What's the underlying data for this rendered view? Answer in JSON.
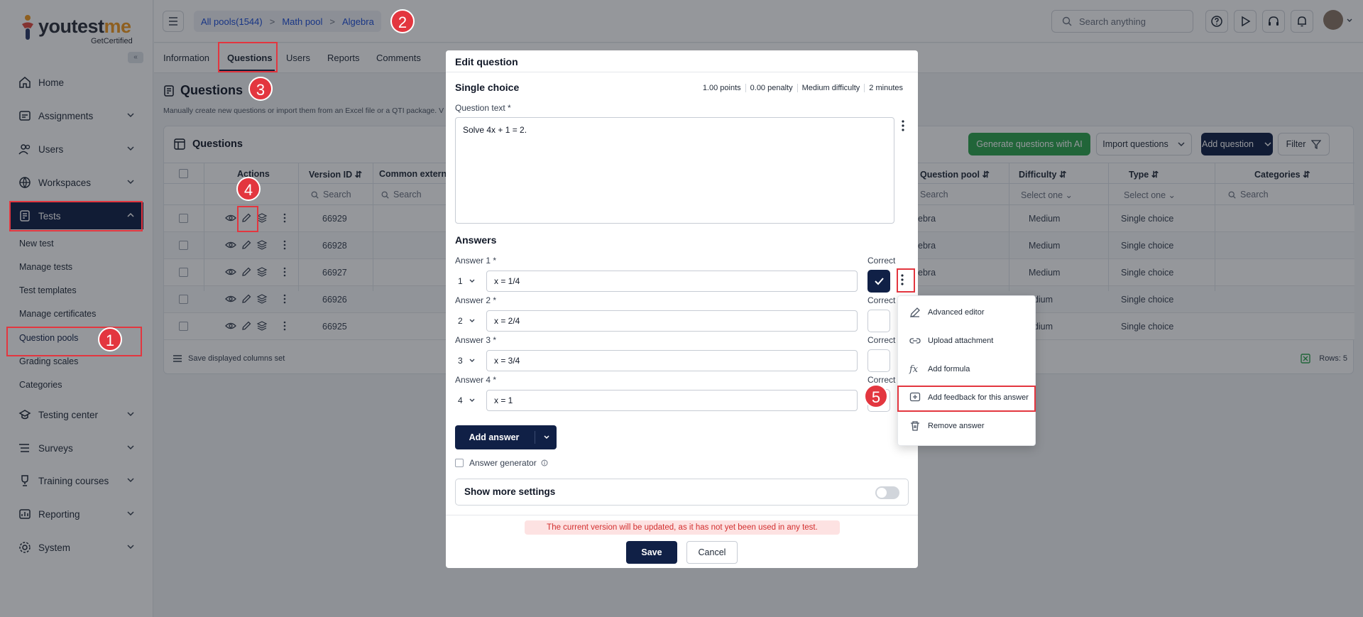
{
  "brand": {
    "name_prefix": "youtest",
    "name_suffix": "me",
    "sub": "GetCertified"
  },
  "sidebar": {
    "items": [
      {
        "label": "Home",
        "icon": "home-icon"
      },
      {
        "label": "Assignments",
        "icon": "assignments-icon"
      },
      {
        "label": "Users",
        "icon": "users-icon"
      },
      {
        "label": "Workspaces",
        "icon": "globe-icon"
      },
      {
        "label": "Tests",
        "icon": "tests-icon"
      },
      {
        "label": "Testing center",
        "icon": "testing-center-icon"
      },
      {
        "label": "Surveys",
        "icon": "surveys-icon"
      },
      {
        "label": "Training courses",
        "icon": "trophy-icon"
      },
      {
        "label": "Reporting",
        "icon": "reporting-icon"
      },
      {
        "label": "System",
        "icon": "gear-icon"
      }
    ],
    "tests_subitems": [
      "New test",
      "Manage tests",
      "Test templates",
      "Manage certificates",
      "Question pools",
      "Grading scales",
      "Categories"
    ]
  },
  "header": {
    "breadcrumbs": [
      "All pools(1544)",
      "Math pool",
      "Algebra"
    ],
    "search_placeholder": "Search anything"
  },
  "tabs": [
    "Information",
    "Questions",
    "Users",
    "Reports",
    "Comments"
  ],
  "page": {
    "title": "Questions",
    "description": "Manually create new questions or import them from an Excel file or a QTI package. V"
  },
  "card": {
    "title": "Questions",
    "buttons": {
      "generate": "Generate questions with AI",
      "import": "Import questions",
      "add": "Add question",
      "filter": "Filter"
    },
    "columns": {
      "actions": "Actions",
      "version_id": "Version ID",
      "common_external": "Common externa",
      "question_pool": "Question pool",
      "difficulty": "Difficulty",
      "type": "Type",
      "categories": "Categories"
    },
    "filters": {
      "search": "Search",
      "select_one": "Select one"
    },
    "rows": [
      {
        "version_id": "66929",
        "pool": "ebra",
        "difficulty": "Medium",
        "type": "Single choice"
      },
      {
        "version_id": "66928",
        "pool": "ebra",
        "difficulty": "Medium",
        "type": "Single choice"
      },
      {
        "version_id": "66927",
        "pool": "ebra",
        "difficulty": "Medium",
        "type": "Single choice"
      },
      {
        "version_id": "66926",
        "pool": "",
        "difficulty": "edium",
        "type": "Single choice"
      },
      {
        "version_id": "66925",
        "pool": "",
        "difficulty": "edium",
        "type": "Single choice"
      }
    ],
    "footer": {
      "save_columns": "Save displayed columns set",
      "rows_count": "Rows: 5"
    }
  },
  "modal": {
    "title": "Edit question",
    "question_type": "Single choice",
    "meta": [
      "1.00 points",
      "0.00 penalty",
      "Medium difficulty",
      "2 minutes"
    ],
    "question_text_label": "Question text *",
    "question_text": "Solve 4x + 1 = 2.",
    "answers_title": "Answers",
    "correct_label": "Correct",
    "answers": [
      {
        "label": "Answer 1 *",
        "order": "1",
        "value": "x = 1/4",
        "correct": true
      },
      {
        "label": "Answer 2 *",
        "order": "2",
        "value": "x = 2/4",
        "correct": false
      },
      {
        "label": "Answer 3 *",
        "order": "3",
        "value": "x = 3/4",
        "correct": false
      },
      {
        "label": "Answer 4 *",
        "order": "4",
        "value": "x = 1",
        "correct": false
      }
    ],
    "add_answer": "Add answer",
    "answer_generator": "Answer generator",
    "show_more": "Show more settings",
    "warning": "The current version will be updated, as it has not yet been used in any test.",
    "save": "Save",
    "cancel": "Cancel"
  },
  "answer_menu": {
    "items": [
      "Advanced editor",
      "Upload attachment",
      "Add formula",
      "Add feedback for this answer",
      "Remove answer"
    ]
  },
  "annotations": [
    "1",
    "2",
    "3",
    "4",
    "5"
  ],
  "colors": {
    "navy": "#102046",
    "green": "#2da44e",
    "highlight": "#e3363f",
    "accent_orange": "#f39a1f"
  }
}
